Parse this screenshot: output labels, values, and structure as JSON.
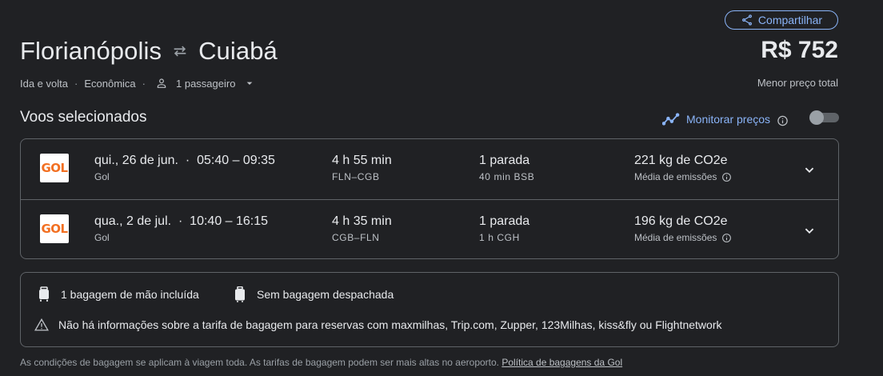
{
  "share": {
    "label": "Compartilhar",
    "icon": "share-icon"
  },
  "route": {
    "origin": "Florianópolis",
    "destination": "Cuiabá",
    "icon": "swap-arrows-icon"
  },
  "trip": {
    "type": "Ida e volta",
    "class": "Econômica",
    "passengers": "1 passageiro"
  },
  "price": {
    "amount": "R$ 752",
    "caption": "Menor preço total"
  },
  "selected": {
    "title": "Voos selecionados",
    "monitor_label": "Monitorar preços",
    "monitor_enabled": false
  },
  "flights": [
    {
      "airline_logo_text": "GOL",
      "date_time": "qui., 26 de jun.  ·  05:40 – 09:35",
      "airline": "Gol",
      "duration": "4 h 55 min",
      "route": "FLN–CGB",
      "stops": "1 parada",
      "stop_detail": "40 min BSB",
      "emissions": "221 kg de CO2e",
      "emissions_label": "Média de emissões"
    },
    {
      "airline_logo_text": "GOL",
      "date_time": "qua., 2 de jul.  ·  10:40 – 16:15",
      "airline": "Gol",
      "duration": "4 h 35 min",
      "route": "CGB–FLN",
      "stops": "1 parada",
      "stop_detail": "1 h CGH",
      "emissions": "196 kg de CO2e",
      "emissions_label": "Média de emissões"
    }
  ],
  "baggage": {
    "carry_on": "1 bagagem de mão incluída",
    "checked": "Sem bagagem despachada",
    "warning": "Não há informações sobre a tarifa de bagagem para reservas com maxmilhas, Trip.com, Zupper, 123Milhas, kiss&fly ou Flightnetwork"
  },
  "footnote": {
    "text": "As condições de bagagem se aplicam à viagem toda. As tarifas de bagagem podem ser mais altas no aeroporto. ",
    "link": "Política de bagagens da Gol"
  },
  "colors": {
    "accent": "#8ab4f8",
    "background": "#202124",
    "logo": "#f26f21"
  }
}
